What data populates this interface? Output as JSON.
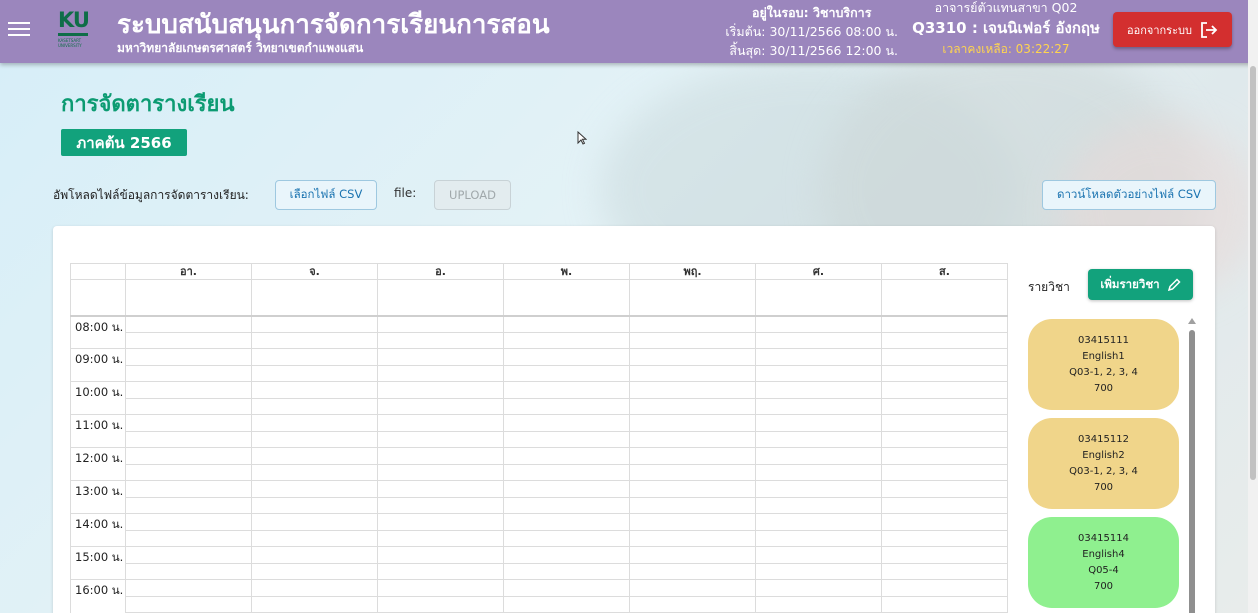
{
  "header": {
    "title": "ระบบสนับสนุนการจัดการเรียนการสอน",
    "subtitle": "มหาวิทยาลัยเกษตรศาสตร์ วิทยาเขตกำแพงแสน",
    "logo_text": "KU",
    "round": {
      "status": "อยู่ในรอบ: วิชาบริการ",
      "start": "เริ่มต้น: 30/11/2566 08:00 น.",
      "end": "สิ้นสุด: 30/11/2566 12:00 น."
    },
    "teacher": {
      "role": "อาจารย์ตัวแทนสาขา Q02",
      "name": "Q3310 : เจนนิเฟอร์ อังกฤษ",
      "time_left": "เวลาคงเหลือ: 03:22:27"
    },
    "logout_label": "ออกจากระบบ"
  },
  "page": {
    "title": "การจัดตารางเรียน",
    "term": "ภาคต้น 2566"
  },
  "upload": {
    "label": "อัพโหลดไฟล์ข้อมูลการจัดตารางเรียน:",
    "choose_label": "เลือกไฟล์ CSV",
    "file_label": "file:",
    "upload_label": "UPLOAD",
    "download_label": "ดาวน์โหลดตัวอย่างไฟล์ CSV"
  },
  "schedule": {
    "days": [
      "อา.",
      "จ.",
      "อ.",
      "พ.",
      "พฤ.",
      "ศ.",
      "ส."
    ],
    "times": [
      "08:00 น.",
      "09:00 น.",
      "10:00 น.",
      "11:00 น.",
      "12:00 น.",
      "13:00 น.",
      "14:00 น.",
      "15:00 น.",
      "16:00 น."
    ]
  },
  "sidebar": {
    "label": "รายวิชา",
    "add_label": "เพิ่มรายวิชา",
    "subjects": [
      {
        "code": "03415111",
        "name": "English1",
        "sections": "Q03-1, 2, 3, 4",
        "count": "700",
        "color": "#f0d58a"
      },
      {
        "code": "03415112",
        "name": "English2",
        "sections": "Q03-1, 2, 3, 4",
        "count": "700",
        "color": "#f0d58a"
      },
      {
        "code": "03415114",
        "name": "English4",
        "sections": "Q05-4",
        "count": "700",
        "color": "#8ff08f"
      }
    ]
  },
  "colors": {
    "header_bg": "#9b86bd",
    "accent_green": "#12a27c",
    "logout_red": "#d32f2f",
    "time_left": "#ffd54f"
  }
}
